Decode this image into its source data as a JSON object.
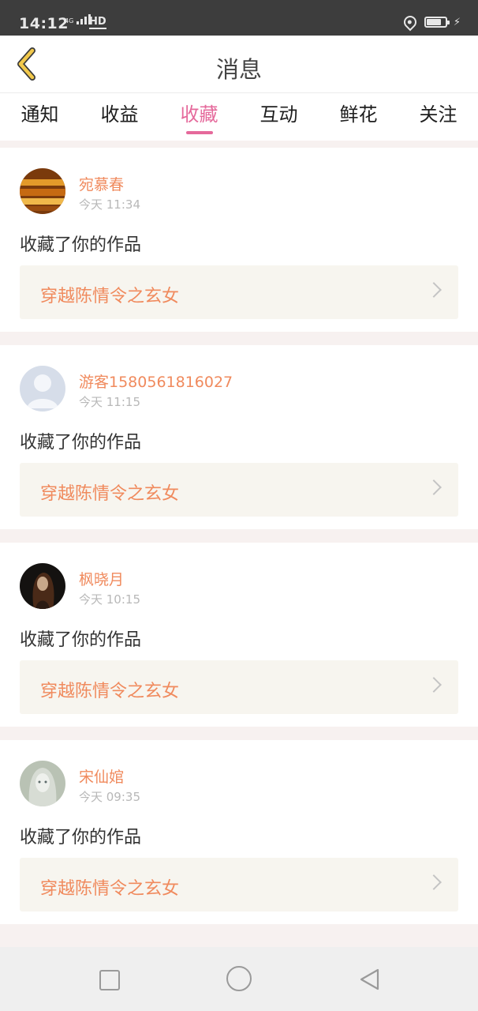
{
  "status_bar": {
    "time": "14:12",
    "network": "4G",
    "hd": "HD",
    "battery_level": 0.8
  },
  "header": {
    "title": "消息",
    "back_icon": "chevron-left-icon"
  },
  "tabs": [
    {
      "label": "通知",
      "active": false
    },
    {
      "label": "收益",
      "active": false
    },
    {
      "label": "收藏",
      "active": true
    },
    {
      "label": "互动",
      "active": false
    },
    {
      "label": "鲜花",
      "active": false
    },
    {
      "label": "关注",
      "active": false
    }
  ],
  "items": [
    {
      "username": "宛慕春",
      "time": "今天 11:34",
      "action": "收藏了你的作品",
      "work_title": "穿越陈情令之玄女"
    },
    {
      "username": "游客1580561816027",
      "time": "今天 11:15",
      "action": "收藏了你的作品",
      "work_title": "穿越陈情令之玄女"
    },
    {
      "username": "枫晓月",
      "time": "今天 10:15",
      "action": "收藏了你的作品",
      "work_title": "穿越陈情令之玄女"
    },
    {
      "username": "宋仙婠",
      "time": "今天 09:35",
      "action": "收藏了你的作品",
      "work_title": "穿越陈情令之玄女"
    }
  ],
  "colors": {
    "accent": "#e5699b",
    "name": "#f08a5d",
    "header_back": "#f2c94c"
  }
}
